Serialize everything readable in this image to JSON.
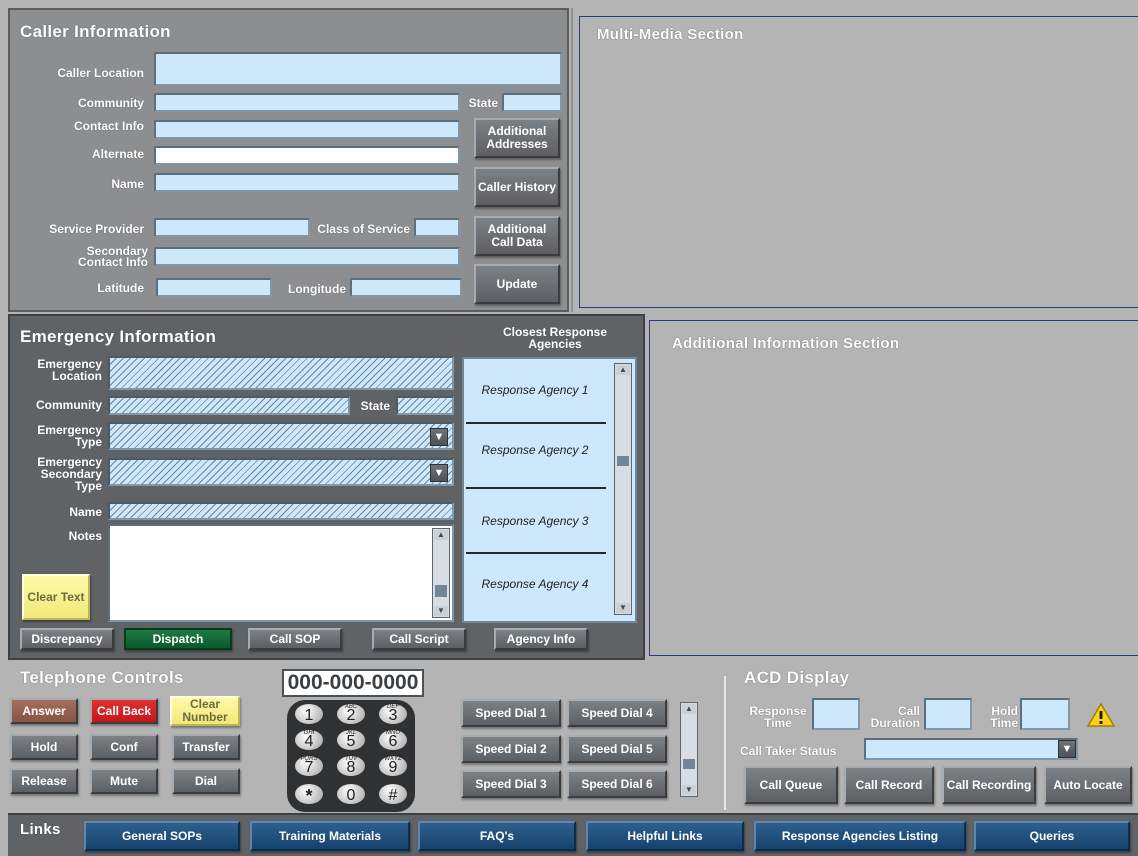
{
  "caller": {
    "title": "Caller Information",
    "labels": {
      "location": "Caller Location",
      "community": "Community",
      "state": "State",
      "contact": "Contact Info",
      "alternate": "Alternate",
      "name": "Name",
      "service_provider": "Service Provider",
      "class_of_service": "Class of Service",
      "secondary_contact": "Secondary Contact Info",
      "latitude": "Latitude",
      "longitude": "Longitude"
    },
    "buttons": {
      "additional_addresses": "Additional Addresses",
      "caller_history": "Caller History",
      "additional_call_data": "Additional Call Data",
      "update": "Update"
    }
  },
  "multimedia": {
    "title": "Multi-Media Section"
  },
  "additional_info": {
    "title": "Additional Information Section"
  },
  "emergency": {
    "title": "Emergency Information",
    "labels": {
      "location": "Emergency Location",
      "community": "Community",
      "state": "State",
      "type": "Emergency Type",
      "secondary_type": "Emergency Secondary Type",
      "name": "Name",
      "notes": "Notes"
    },
    "clear_text": "Clear Text",
    "agencies_title": "Closest Response Agencies",
    "agencies": [
      "Response Agency 1",
      "Response Agency 2",
      "Response Agency 3",
      "Response Agency 4"
    ],
    "buttons": {
      "discrepancy": "Discrepancy",
      "dispatch": "Dispatch",
      "call_sop": "Call SOP",
      "call_script": "Call Script",
      "agency_info": "Agency Info"
    }
  },
  "telephone": {
    "title": "Telephone Controls",
    "number": "000-000-0000",
    "buttons": {
      "answer": "Answer",
      "call_back": "Call Back",
      "clear_number": "Clear Number",
      "hold": "Hold",
      "conf": "Conf",
      "transfer": "Transfer",
      "release": "Release",
      "mute": "Mute",
      "dial": "Dial"
    },
    "keypad": [
      {
        "n": "1",
        "s": ""
      },
      {
        "n": "2",
        "s": "ABC"
      },
      {
        "n": "3",
        "s": "DEF"
      },
      {
        "n": "4",
        "s": "GHI"
      },
      {
        "n": "5",
        "s": "JKL"
      },
      {
        "n": "6",
        "s": "MNO"
      },
      {
        "n": "7",
        "s": "PQRS"
      },
      {
        "n": "8",
        "s": "TUV"
      },
      {
        "n": "9",
        "s": "WXYZ"
      },
      {
        "n": "*",
        "s": ""
      },
      {
        "n": "0",
        "s": ""
      },
      {
        "n": "#",
        "s": ""
      }
    ],
    "speed_dials": [
      "Speed Dial 1",
      "Speed Dial 2",
      "Speed Dial 3",
      "Speed Dial 4",
      "Speed Dial 5",
      "Speed Dial 6"
    ]
  },
  "acd": {
    "title": "ACD Display",
    "labels": {
      "response_time": "Response Time",
      "call_duration": "Call Duration",
      "hold_time": "Hold Time",
      "status": "Call Taker Status"
    },
    "buttons": {
      "call_queue": "Call Queue",
      "call_record": "Call Record",
      "call_recording": "Call Recording",
      "auto_locate": "Auto Locate"
    },
    "warning_icon": "warning-icon"
  },
  "links": {
    "title": "Links",
    "items": [
      "General SOPs",
      "Training Materials",
      "FAQ's",
      "Helpful Links",
      "Response Agencies Listing",
      "Queries"
    ]
  },
  "colors": {
    "panel_dark": "#5f6366",
    "panel_mid": "#8c8e90",
    "field": "#cde7fb",
    "link_blue": "#16426d",
    "red": "#d62020",
    "yellow": "#f7ef8e",
    "green": "#0f6532",
    "section_border": "#2a3a7a"
  }
}
